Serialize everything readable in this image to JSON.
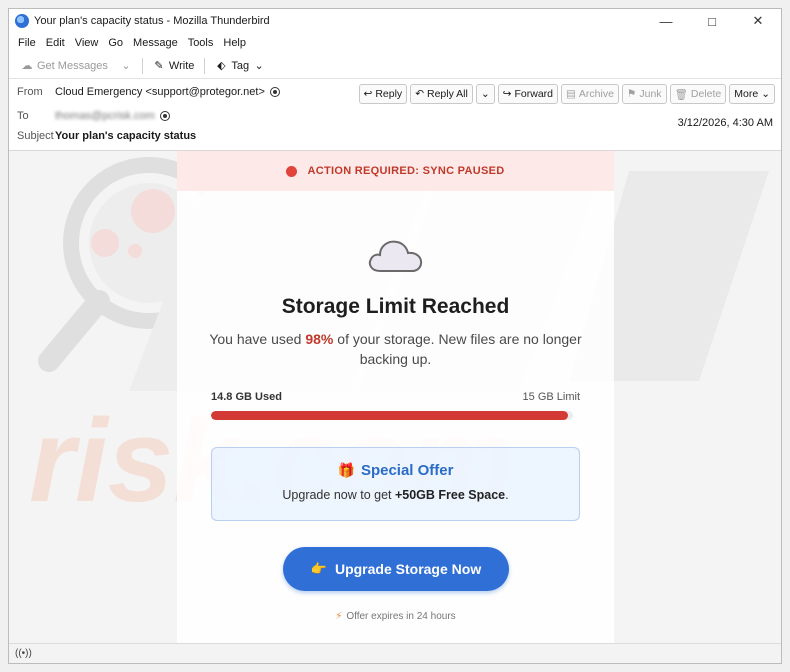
{
  "window": {
    "title": "Your plan's capacity status - Mozilla Thunderbird"
  },
  "menu": [
    "File",
    "Edit",
    "View",
    "Go",
    "Message",
    "Tools",
    "Help"
  ],
  "toolbar": {
    "get_messages": "Get Messages",
    "write": "Write",
    "tag": "Tag"
  },
  "header": {
    "from_label": "From",
    "from_value": "Cloud Emergency <support@protegor.net>",
    "to_label": "To",
    "to_value": "thomas@pcrisk.com",
    "subject_label": "Subject",
    "subject_value": "Your plan's capacity status",
    "date": "3/12/2026, 4:30 AM"
  },
  "actions": {
    "reply": "Reply",
    "reply_all": "Reply All",
    "forward": "Forward",
    "archive": "Archive",
    "junk": "Junk",
    "delete": "Delete",
    "more": "More"
  },
  "email": {
    "alert": "ACTION REQUIRED: SYNC PAUSED",
    "headline": "Storage Limit Reached",
    "desc_before": "You have used ",
    "percent": "98%",
    "desc_after": " of your storage. New files are no longer backing up.",
    "used_label": "14.8 GB Used",
    "limit_label": "15 GB Limit",
    "usage_fraction": 0.987,
    "offer_title": "Special Offer",
    "offer_before": "Upgrade now to get ",
    "offer_bold": "+50GB Free Space",
    "offer_after": ".",
    "cta": "Upgrade Storage Now",
    "expire": "Offer expires in 24 hours"
  },
  "watermark": {
    "text": "risk.com"
  },
  "colors": {
    "accent": "#2f6fd6",
    "alert": "#c0392b",
    "bar": "#d33a36"
  }
}
